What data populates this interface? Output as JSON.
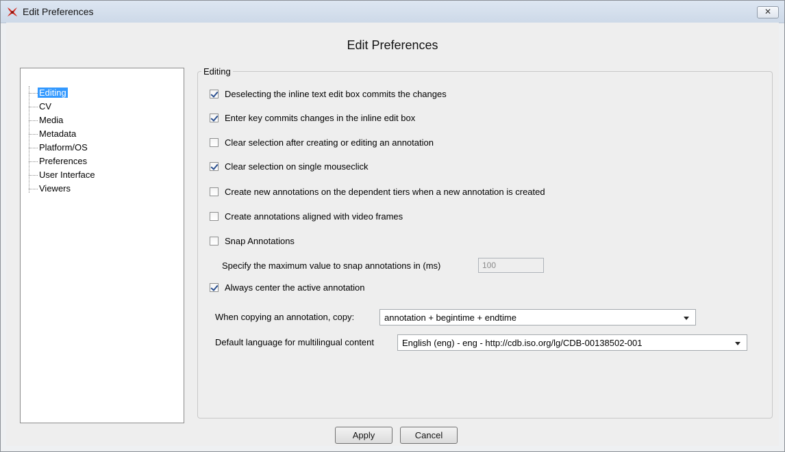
{
  "window": {
    "title": "Edit Preferences",
    "close_symbol": "✕"
  },
  "heading": "Edit Preferences",
  "sidebar": {
    "items": [
      {
        "label": "Editing",
        "selected": true
      },
      {
        "label": "CV"
      },
      {
        "label": "Media"
      },
      {
        "label": "Metadata"
      },
      {
        "label": "Platform/OS"
      },
      {
        "label": "Preferences"
      },
      {
        "label": "User Interface"
      },
      {
        "label": "Viewers"
      }
    ]
  },
  "editing": {
    "group_title": "Editing",
    "options": [
      {
        "label": "Deselecting the inline text edit box commits the changes",
        "checked": true
      },
      {
        "label": "Enter key commits changes in the inline edit box",
        "checked": true
      },
      {
        "label": "Clear selection after creating or editing an annotation",
        "checked": false
      },
      {
        "label": "Clear selection on single mouseclick",
        "checked": true
      },
      {
        "label": "Create new annotations on the dependent tiers when a new annotation is created",
        "checked": false
      },
      {
        "label": "Create annotations aligned with video frames",
        "checked": false
      },
      {
        "label": "Snap Annotations",
        "checked": false
      },
      {
        "label": "Always center the active annotation",
        "checked": true
      }
    ],
    "snap_max_label": "Specify the maximum value to snap annotations in (ms)",
    "snap_max_value": "100",
    "copy_label": "When copying an annotation, copy:",
    "copy_value": "annotation + begintime + endtime",
    "language_label": "Default language for multilingual content",
    "language_value": "English (eng) - eng - http://cdb.iso.org/lg/CDB-00138502-001"
  },
  "buttons": {
    "apply": "Apply",
    "cancel": "Cancel"
  },
  "colors": {
    "selection": "#3399ff",
    "checkmark": "#2a4f8f"
  }
}
